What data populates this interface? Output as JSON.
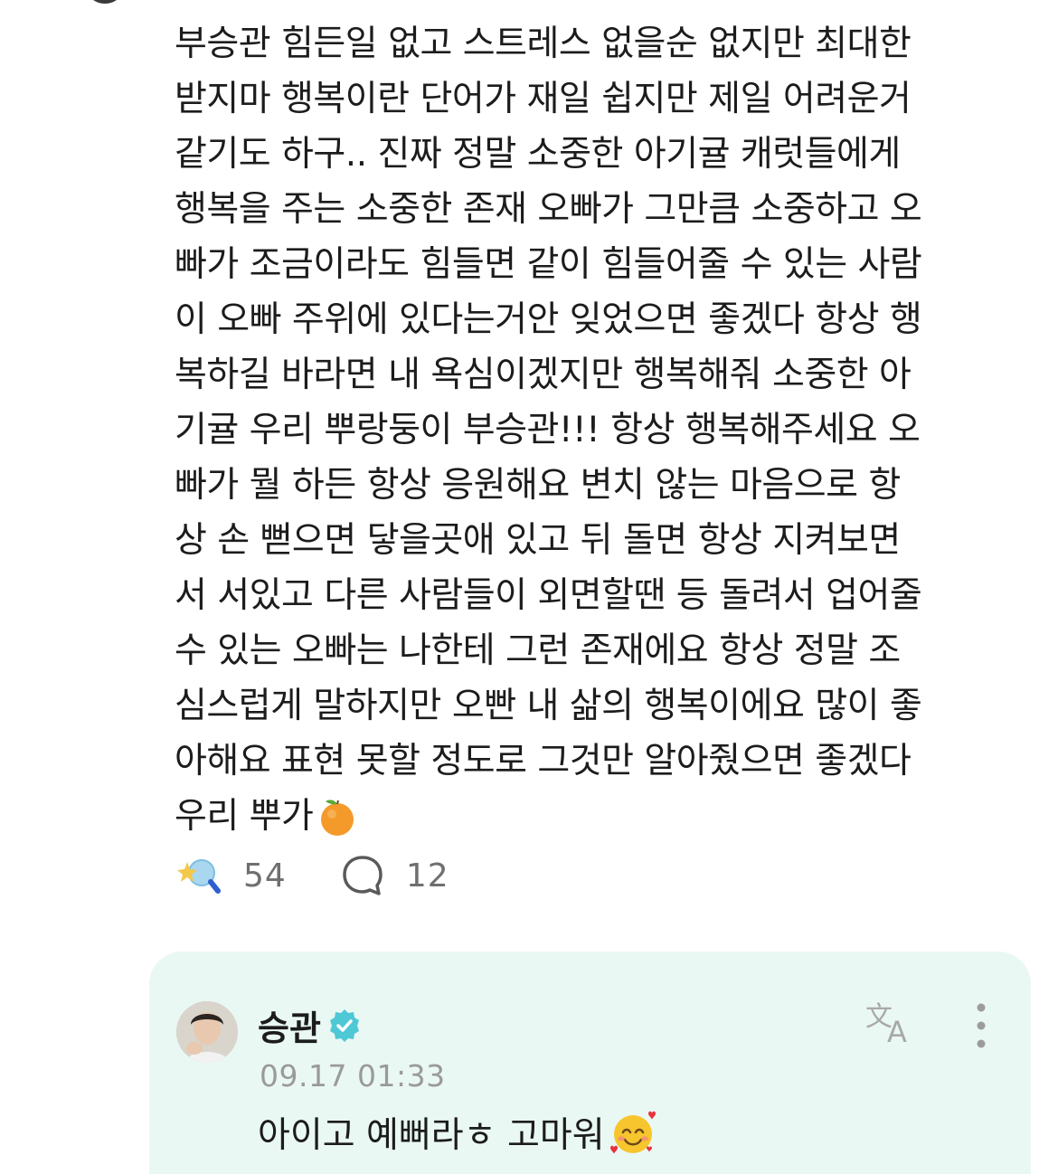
{
  "post": {
    "lines": [
      "부승관 힘든일 없고 스트레스 없을순 없지만 최대한",
      "받지마 행복이란 단어가 재일 쉽지만 제일 어려운거",
      "같기도 하구.. 진짜 정말 소중한 아기귤 캐럿들에게",
      "행복을 주는 소중한 존재 오빠가 그만큼 소중하고 오",
      "빠가 조금이라도 힘들면 같이 힘들어줄 수 있는 사람",
      "이 오빠 주위에 있다는거안 잊었으면 좋겠다 항상 행",
      "복하길 바라면 내 욕심이겠지만 행복해줘 소중한 아",
      "기귤 우리 뿌랑둥이 부승관!!! 항상 행복해주세요 오",
      "빠가 뭘 하든 항상 응원해요 변치 않는 마음으로 항",
      "상 손 뻗으면 닿을곳애 있고 뒤 돌면 항상 지켜보면",
      "서 서있고 다른 사람들이 외면할땐 등 돌려서 업어줄",
      "수 있는 오빠는 나한테 그런 존재에요 항상 정말 조",
      "심스럽게 말하지만 오빤 내 삶의 행복이에요 많이 좋",
      "아해요 표현 못할 정도로 그것만 알아줬으면 좋겠다"
    ],
    "last_line": "우리 뿌가",
    "last_line_emoji": "tangerine-emoji"
  },
  "actions": {
    "like_icon": "sparkle-lightstick-icon",
    "like_count": "54",
    "comment_icon": "speech-bubble-icon",
    "comment_count": "12"
  },
  "reply": {
    "author": "승관",
    "verified_icon": "verified-badge-icon",
    "timestamp": "09.17 01:33",
    "text": "아이고 예뻐라ㅎ 고마워",
    "text_emoji": "smiling-face-with-hearts-emoji",
    "translate_icon": "translate-icon",
    "more_icon": "more-vertical-icon"
  },
  "colors": {
    "text": "#1c1c1c",
    "muted": "#6f6f6f",
    "timestamp": "#9a9a9a",
    "reply_background": "#eaf8f4",
    "verified": "#4fc8d6",
    "icon_gray": "#9c9c9c"
  }
}
